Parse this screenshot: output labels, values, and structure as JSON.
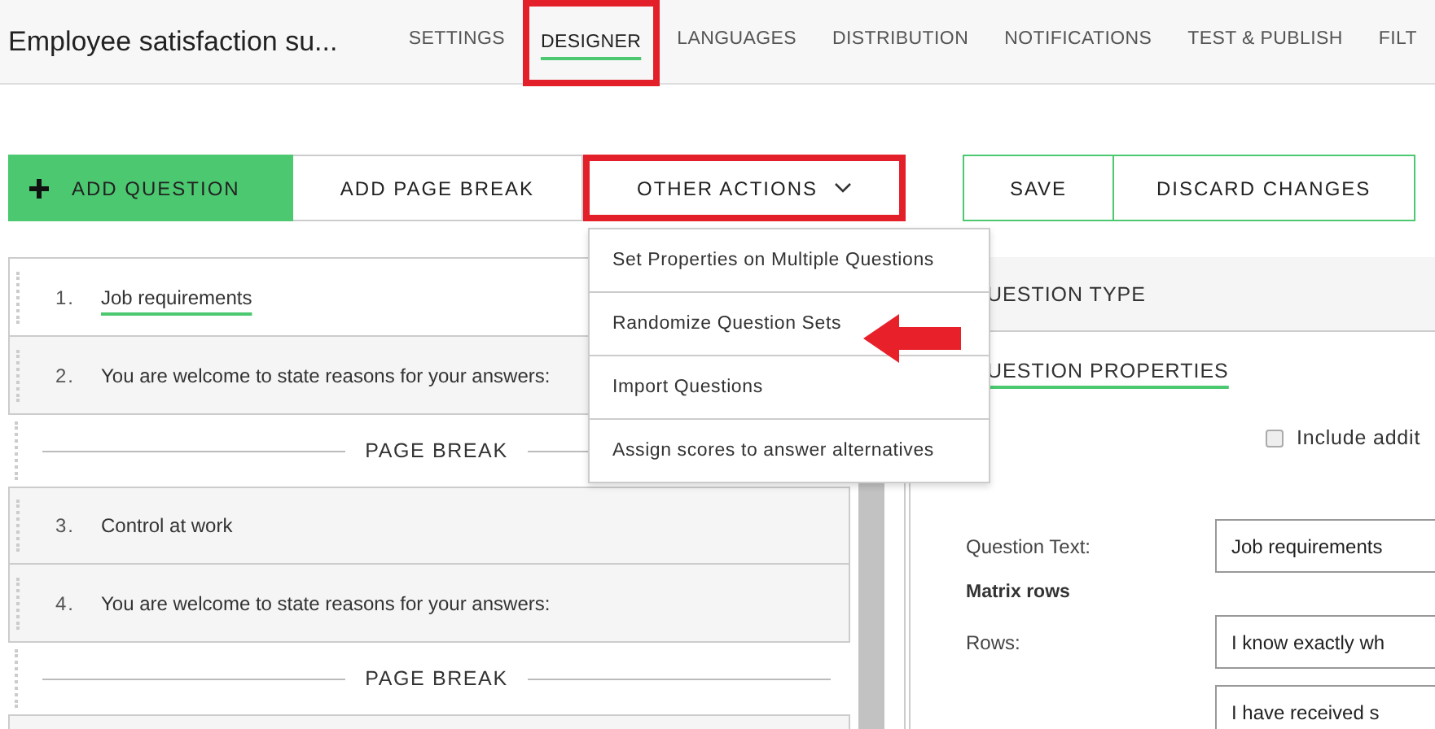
{
  "survey_title": "Employee satisfaction su...",
  "nav_tabs": [
    {
      "label": "SETTINGS",
      "selected": false,
      "highlighted": false
    },
    {
      "label": "DESIGNER",
      "selected": true,
      "highlighted": true
    },
    {
      "label": "LANGUAGES",
      "selected": false,
      "highlighted": false
    },
    {
      "label": "DISTRIBUTION",
      "selected": false,
      "highlighted": false
    },
    {
      "label": "NOTIFICATIONS",
      "selected": false,
      "highlighted": false
    },
    {
      "label": "TEST & PUBLISH",
      "selected": false,
      "highlighted": false
    },
    {
      "label": "FILT",
      "selected": false,
      "highlighted": false
    }
  ],
  "toolbar": [
    {
      "label": "ADD QUESTION",
      "kind": "primary",
      "highlighted": false
    },
    {
      "label": "ADD PAGE BREAK",
      "kind": "plain",
      "highlighted": false
    },
    {
      "label": "OTHER ACTIONS",
      "kind": "dropdown",
      "highlighted": true
    },
    {
      "label": "SAVE",
      "kind": "outline",
      "highlighted": false
    },
    {
      "label": "DISCARD CHANGES",
      "kind": "outline",
      "highlighted": false
    }
  ],
  "actions_menu": [
    {
      "label": "Set Properties on Multiple Questions",
      "pointed_at": false
    },
    {
      "label": "Randomize Question Sets",
      "pointed_at": true
    },
    {
      "label": "Import Questions",
      "pointed_at": false
    },
    {
      "label": "Assign scores to answer alternatives",
      "pointed_at": false
    }
  ],
  "question_list": [
    {
      "kind": "question",
      "number": "1.",
      "text": "Job requirements",
      "selected": true
    },
    {
      "kind": "question",
      "number": "2.",
      "text": "You are welcome to state reasons for your answers:",
      "selected": false
    },
    {
      "kind": "page_break",
      "label": "PAGE BREAK"
    },
    {
      "kind": "question",
      "number": "3.",
      "text": "Control at work",
      "selected": false
    },
    {
      "kind": "question",
      "number": "4.",
      "text": "You are welcome to state reasons for your answers:",
      "selected": false
    },
    {
      "kind": "page_break",
      "label": "PAGE BREAK"
    }
  ],
  "properties": {
    "section_header": "UESTION TYPE",
    "tab": "UESTION PROPERTIES",
    "checkbox": {
      "label": "Include addit",
      "checked": false
    },
    "fields": [
      {
        "kind": "field",
        "label": "Question Text:",
        "value": "Job requirements"
      },
      {
        "kind": "heading",
        "label": "Matrix rows"
      },
      {
        "kind": "field",
        "label": "Rows:",
        "value": "I know exactly wh"
      },
      {
        "kind": "field",
        "value": "I have received s"
      }
    ]
  }
}
